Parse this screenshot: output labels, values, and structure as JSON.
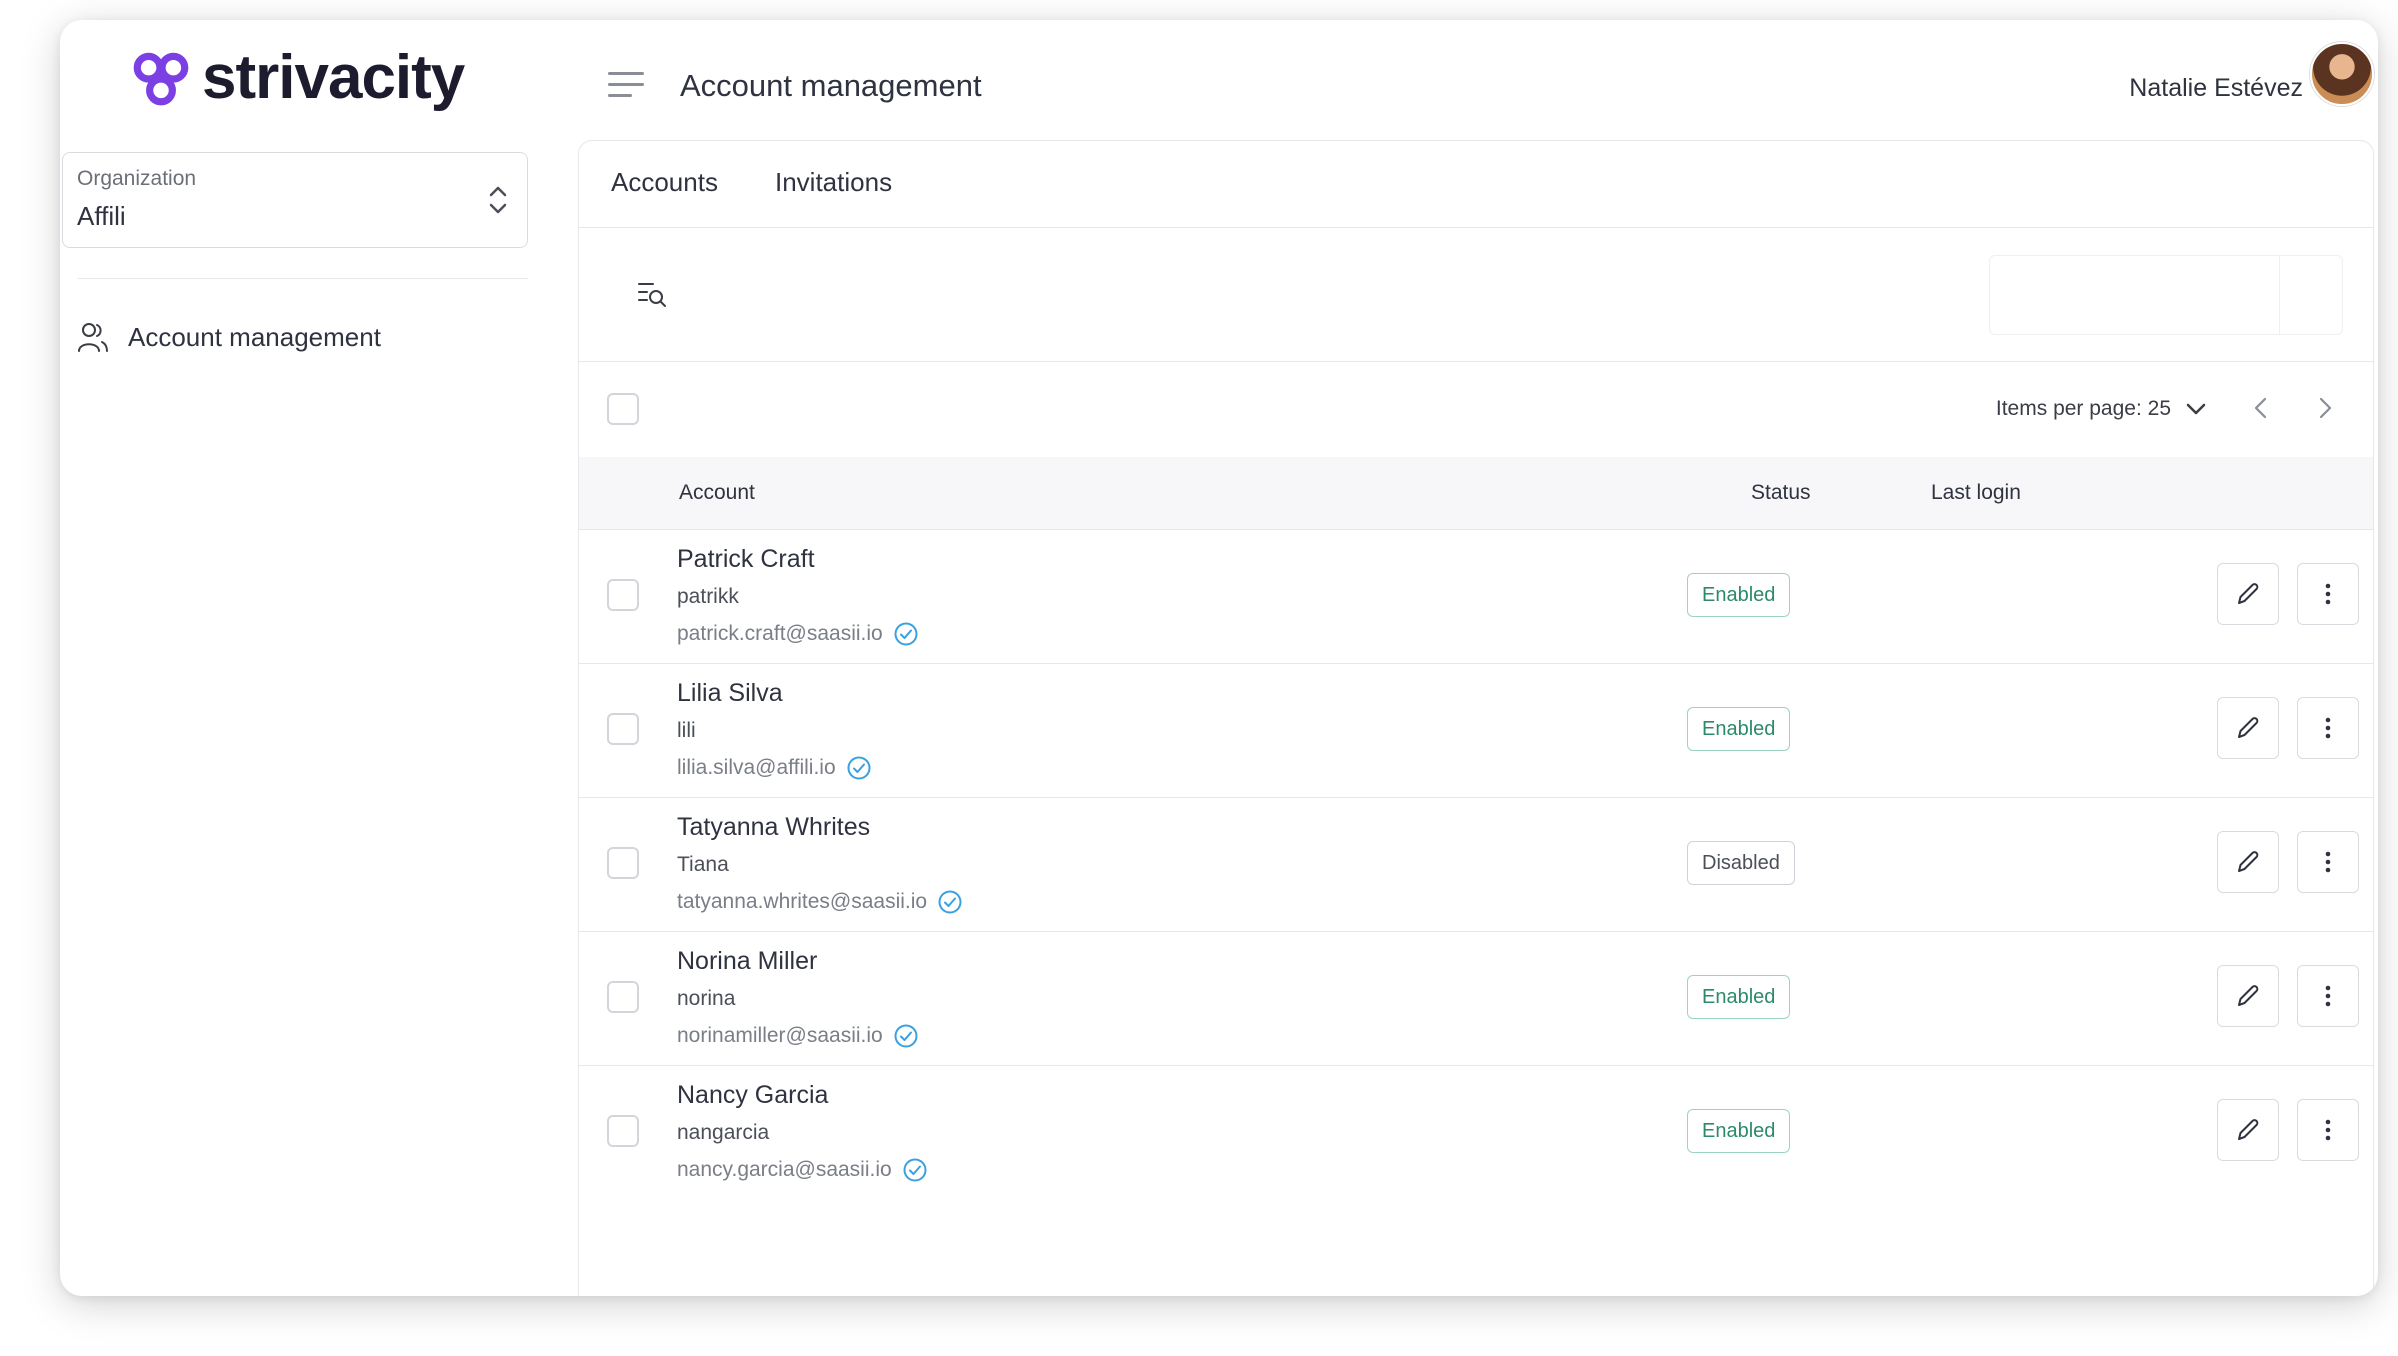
{
  "brand": {
    "name": "strivacity",
    "color": "#7b3fe4"
  },
  "header": {
    "title": "Account management",
    "user_name": "Natalie Estévez"
  },
  "sidebar": {
    "organization": {
      "label": "Organization",
      "value": "Affili"
    },
    "items": [
      {
        "label": "Account management",
        "icon": "users-icon"
      }
    ]
  },
  "tabs": [
    {
      "label": "Accounts"
    },
    {
      "label": "Invitations"
    }
  ],
  "toolbar": {
    "filter_icon": "filter-search-icon",
    "search_placeholder": ""
  },
  "pagination": {
    "items_per_page_label": "Items per page: 25"
  },
  "table": {
    "columns": {
      "account": "Account",
      "status": "Status",
      "last_login": "Last login"
    },
    "rows": [
      {
        "name": "Patrick Craft",
        "username": "patrikk",
        "email": "patrick.craft@saasii.io",
        "status": "Enabled",
        "last_login": ""
      },
      {
        "name": "Lilia Silva",
        "username": "lili",
        "email": "lilia.silva@affili.io",
        "status": "Enabled",
        "last_login": ""
      },
      {
        "name": "Tatyanna Whrites",
        "username": "Tiana",
        "email": "tatyanna.whrites@saasii.io",
        "status": "Disabled",
        "last_login": ""
      },
      {
        "name": "Norina Miller",
        "username": "norina",
        "email": "norinamiller@saasii.io",
        "status": "Enabled",
        "last_login": ""
      },
      {
        "name": "Nancy Garcia",
        "username": "nangarcia",
        "email": "nancy.garcia@saasii.io",
        "status": "Enabled",
        "last_login": ""
      }
    ]
  },
  "colors": {
    "verified": "#3aa0e0",
    "enabled": "#2b8a6b",
    "border": "#e6e7eb"
  }
}
